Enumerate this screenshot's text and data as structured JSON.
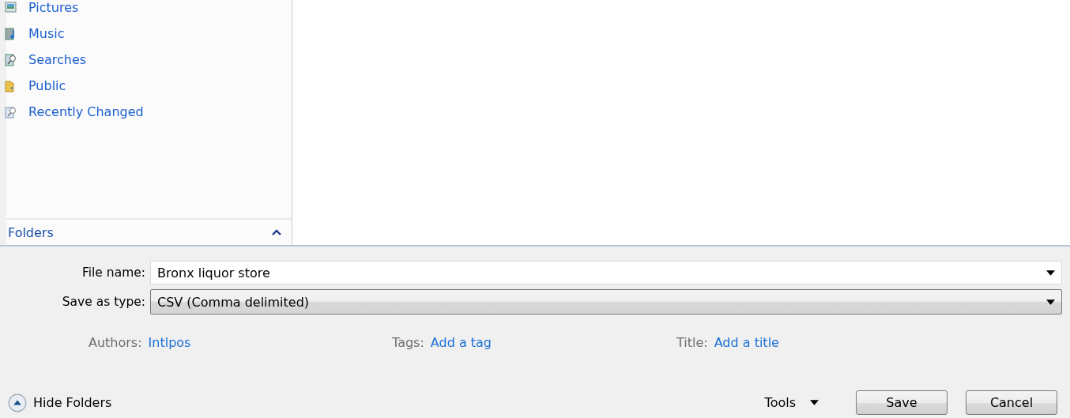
{
  "nav": {
    "items": [
      {
        "label": "Pictures",
        "kind": "pictures"
      },
      {
        "label": "Music",
        "kind": "music"
      },
      {
        "label": "Searches",
        "kind": "search"
      },
      {
        "label": "Public",
        "kind": "folder"
      },
      {
        "label": "Recently Changed",
        "kind": "recent"
      }
    ],
    "folders_label": "Folders",
    "folders_expanded": true
  },
  "file_name": {
    "label": "File name:",
    "value": "Bronx liquor store"
  },
  "save_as_type": {
    "label": "Save as type:",
    "value": "CSV (Comma delimited)"
  },
  "meta": [
    {
      "label": "Authors:",
      "value": "Intlpos"
    },
    {
      "label": "Tags:",
      "value": "Add a tag"
    },
    {
      "label": "Title:",
      "value": "Add a title"
    }
  ],
  "hide_folders": "Hide Folders",
  "tools": "Tools",
  "buttons": [
    "Save",
    "Cancel"
  ]
}
